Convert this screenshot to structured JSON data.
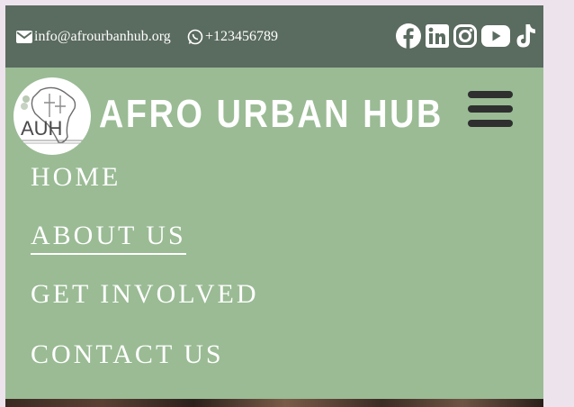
{
  "topbar": {
    "email": "info@afrourbanhub.org",
    "phone": "+123456789",
    "social": [
      "facebook-icon",
      "linkedin-icon",
      "instagram-icon",
      "youtube-icon",
      "tiktok-icon"
    ]
  },
  "brand": {
    "logo_text": "AUH",
    "title": "AFRO URBAN HUB"
  },
  "nav": {
    "items": [
      {
        "label": "HOME",
        "active": false
      },
      {
        "label": "ABOUT US",
        "active": true
      },
      {
        "label": "GET INVOLVED",
        "active": false
      },
      {
        "label": "CONTACT US",
        "active": false
      }
    ]
  },
  "colors": {
    "topbar_bg": "#5a6b5f",
    "header_bg": "#9abb94",
    "page_bg": "#ede3ec"
  }
}
